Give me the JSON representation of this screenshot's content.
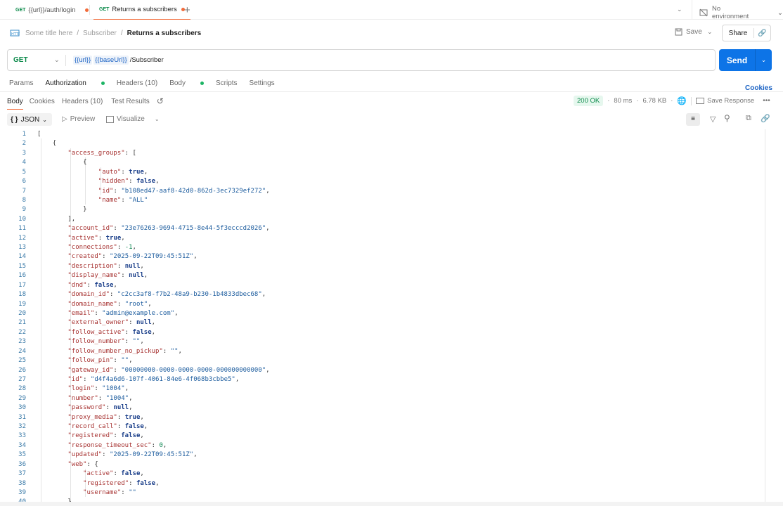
{
  "tabs": [
    {
      "method": "GET",
      "label": "{{url}}/auth/login",
      "active": false
    },
    {
      "method": "GET",
      "label": "Returns a subscribers",
      "active": true
    }
  ],
  "environment": "No environment",
  "breadcrumb": {
    "items": [
      "Some title here",
      "Subscriber"
    ],
    "current": "Returns a subscribers"
  },
  "toolbar": {
    "save": "Save",
    "share": "Share"
  },
  "request": {
    "method": "GET",
    "url_vars": [
      "{{url}}",
      "{{baseUrl}}"
    ],
    "url_path": "/Subscriber",
    "send": "Send"
  },
  "request_tabs": [
    "Params",
    "Authorization",
    "Headers (10)",
    "Body",
    "Scripts",
    "Settings"
  ],
  "cookies_link": "Cookies",
  "response_tabs": [
    "Body",
    "Cookies",
    "Headers (10)",
    "Test Results"
  ],
  "status": {
    "code": "200 OK",
    "time": "80 ms",
    "size": "6.78 KB",
    "save_response": "Save Response",
    "status_color": "#e6f7ee"
  },
  "view": {
    "format": "JSON",
    "preview": "Preview",
    "visualize": "Visualize"
  },
  "colors": {
    "accent": "#f26b3a",
    "send": "#0d74e7",
    "method": "#0b8a4a"
  },
  "code_lines": [
    [
      0,
      [
        [
          "[",
          "p"
        ]
      ]
    ],
    [
      1,
      [
        [
          "{",
          "p"
        ]
      ]
    ],
    [
      2,
      [
        [
          "\"access_groups\"",
          "k"
        ],
        [
          ": [",
          "p"
        ]
      ]
    ],
    [
      3,
      [
        [
          "{",
          "p"
        ]
      ]
    ],
    [
      4,
      [
        [
          "\"auto\"",
          "k"
        ],
        [
          ": ",
          "p"
        ],
        [
          "true",
          "b"
        ],
        [
          ",",
          "p"
        ]
      ]
    ],
    [
      4,
      [
        [
          "\"hidden\"",
          "k"
        ],
        [
          ": ",
          "p"
        ],
        [
          "false",
          "b"
        ],
        [
          ",",
          "p"
        ]
      ]
    ],
    [
      4,
      [
        [
          "\"id\"",
          "k"
        ],
        [
          ": ",
          "p"
        ],
        [
          "\"b108ed47-aaf8-42d0-862d-3ec7329ef272\"",
          "s"
        ],
        [
          ",",
          "p"
        ]
      ]
    ],
    [
      4,
      [
        [
          "\"name\"",
          "k"
        ],
        [
          ": ",
          "p"
        ],
        [
          "\"ALL\"",
          "s"
        ]
      ]
    ],
    [
      3,
      [
        [
          "}",
          "p"
        ]
      ]
    ],
    [
      2,
      [
        [
          "],",
          "p"
        ]
      ]
    ],
    [
      2,
      [
        [
          "\"account_id\"",
          "k"
        ],
        [
          ": ",
          "p"
        ],
        [
          "\"23e76263-9694-4715-8e44-5f3ecccd2026\"",
          "s"
        ],
        [
          ",",
          "p"
        ]
      ]
    ],
    [
      2,
      [
        [
          "\"active\"",
          "k"
        ],
        [
          ": ",
          "p"
        ],
        [
          "true",
          "b"
        ],
        [
          ",",
          "p"
        ]
      ]
    ],
    [
      2,
      [
        [
          "\"connections\"",
          "k"
        ],
        [
          ": ",
          "p"
        ],
        [
          "-1",
          "n"
        ],
        [
          ",",
          "p"
        ]
      ]
    ],
    [
      2,
      [
        [
          "\"created\"",
          "k"
        ],
        [
          ": ",
          "p"
        ],
        [
          "\"2025-09-22T09:45:51Z\"",
          "s"
        ],
        [
          ",",
          "p"
        ]
      ]
    ],
    [
      2,
      [
        [
          "\"description\"",
          "k"
        ],
        [
          ": ",
          "p"
        ],
        [
          "null",
          "b"
        ],
        [
          ",",
          "p"
        ]
      ]
    ],
    [
      2,
      [
        [
          "\"display_name\"",
          "k"
        ],
        [
          ": ",
          "p"
        ],
        [
          "null",
          "b"
        ],
        [
          ",",
          "p"
        ]
      ]
    ],
    [
      2,
      [
        [
          "\"dnd\"",
          "k"
        ],
        [
          ": ",
          "p"
        ],
        [
          "false",
          "b"
        ],
        [
          ",",
          "p"
        ]
      ]
    ],
    [
      2,
      [
        [
          "\"domain_id\"",
          "k"
        ],
        [
          ": ",
          "p"
        ],
        [
          "\"c2cc3af8-f7b2-48a9-b230-1b4833dbec68\"",
          "s"
        ],
        [
          ",",
          "p"
        ]
      ]
    ],
    [
      2,
      [
        [
          "\"domain_name\"",
          "k"
        ],
        [
          ": ",
          "p"
        ],
        [
          "\"root\"",
          "s"
        ],
        [
          ",",
          "p"
        ]
      ]
    ],
    [
      2,
      [
        [
          "\"email\"",
          "k"
        ],
        [
          ": ",
          "p"
        ],
        [
          "\"admin@example.com\"",
          "s"
        ],
        [
          ",",
          "p"
        ]
      ]
    ],
    [
      2,
      [
        [
          "\"external_owner\"",
          "k"
        ],
        [
          ": ",
          "p"
        ],
        [
          "null",
          "b"
        ],
        [
          ",",
          "p"
        ]
      ]
    ],
    [
      2,
      [
        [
          "\"follow_active\"",
          "k"
        ],
        [
          ": ",
          "p"
        ],
        [
          "false",
          "b"
        ],
        [
          ",",
          "p"
        ]
      ]
    ],
    [
      2,
      [
        [
          "\"follow_number\"",
          "k"
        ],
        [
          ": ",
          "p"
        ],
        [
          "\"\"",
          "s"
        ],
        [
          ",",
          "p"
        ]
      ]
    ],
    [
      2,
      [
        [
          "\"follow_number_no_pickup\"",
          "k"
        ],
        [
          ": ",
          "p"
        ],
        [
          "\"\"",
          "s"
        ],
        [
          ",",
          "p"
        ]
      ]
    ],
    [
      2,
      [
        [
          "\"follow_pin\"",
          "k"
        ],
        [
          ": ",
          "p"
        ],
        [
          "\"\"",
          "s"
        ],
        [
          ",",
          "p"
        ]
      ]
    ],
    [
      2,
      [
        [
          "\"gateway_id\"",
          "k"
        ],
        [
          ": ",
          "p"
        ],
        [
          "\"00000000-0000-0000-0000-000000000000\"",
          "s"
        ],
        [
          ",",
          "p"
        ]
      ]
    ],
    [
      2,
      [
        [
          "\"id\"",
          "k"
        ],
        [
          ": ",
          "p"
        ],
        [
          "\"d4f4a6d6-107f-4061-84e6-4f068b3cbbe5\"",
          "s"
        ],
        [
          ",",
          "p"
        ]
      ]
    ],
    [
      2,
      [
        [
          "\"login\"",
          "k"
        ],
        [
          ": ",
          "p"
        ],
        [
          "\"1004\"",
          "s"
        ],
        [
          ",",
          "p"
        ]
      ]
    ],
    [
      2,
      [
        [
          "\"number\"",
          "k"
        ],
        [
          ": ",
          "p"
        ],
        [
          "\"1004\"",
          "s"
        ],
        [
          ",",
          "p"
        ]
      ]
    ],
    [
      2,
      [
        [
          "\"password\"",
          "k"
        ],
        [
          ": ",
          "p"
        ],
        [
          "null",
          "b"
        ],
        [
          ",",
          "p"
        ]
      ]
    ],
    [
      2,
      [
        [
          "\"proxy_media\"",
          "k"
        ],
        [
          ": ",
          "p"
        ],
        [
          "true",
          "b"
        ],
        [
          ",",
          "p"
        ]
      ]
    ],
    [
      2,
      [
        [
          "\"record_call\"",
          "k"
        ],
        [
          ": ",
          "p"
        ],
        [
          "false",
          "b"
        ],
        [
          ",",
          "p"
        ]
      ]
    ],
    [
      2,
      [
        [
          "\"registered\"",
          "k"
        ],
        [
          ": ",
          "p"
        ],
        [
          "false",
          "b"
        ],
        [
          ",",
          "p"
        ]
      ]
    ],
    [
      2,
      [
        [
          "\"response_timeout_sec\"",
          "k"
        ],
        [
          ": ",
          "p"
        ],
        [
          "0",
          "n"
        ],
        [
          ",",
          "p"
        ]
      ]
    ],
    [
      2,
      [
        [
          "\"updated\"",
          "k"
        ],
        [
          ": ",
          "p"
        ],
        [
          "\"2025-09-22T09:45:51Z\"",
          "s"
        ],
        [
          ",",
          "p"
        ]
      ]
    ],
    [
      2,
      [
        [
          "\"web\"",
          "k"
        ],
        [
          ": {",
          "p"
        ]
      ]
    ],
    [
      3,
      [
        [
          "\"active\"",
          "k"
        ],
        [
          ": ",
          "p"
        ],
        [
          "false",
          "b"
        ],
        [
          ",",
          "p"
        ]
      ]
    ],
    [
      3,
      [
        [
          "\"registered\"",
          "k"
        ],
        [
          ": ",
          "p"
        ],
        [
          "false",
          "b"
        ],
        [
          ",",
          "p"
        ]
      ]
    ],
    [
      3,
      [
        [
          "\"username\"",
          "k"
        ],
        [
          ": ",
          "p"
        ],
        [
          "\"\"",
          "s"
        ]
      ]
    ],
    [
      2,
      [
        [
          "}",
          "p"
        ]
      ]
    ]
  ]
}
